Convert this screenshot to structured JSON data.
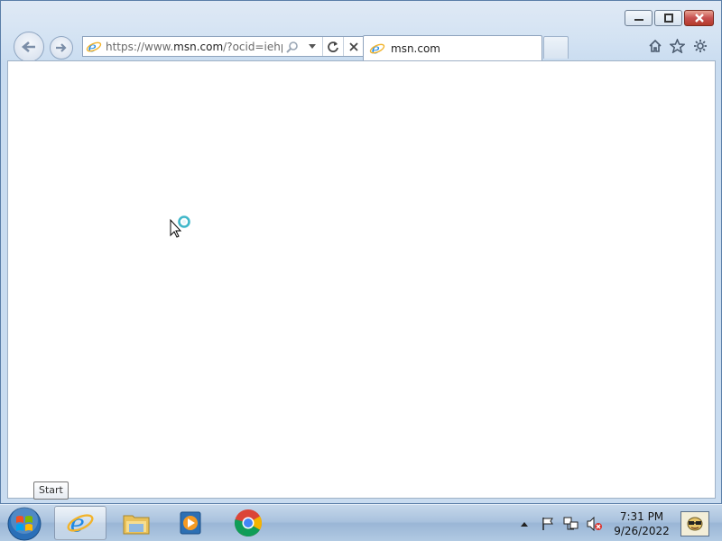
{
  "browser": {
    "address": {
      "prefix": "https://www.",
      "domain": "msn.com",
      "suffix": "/?ocid=iehp"
    },
    "tab": {
      "label": "msn.com"
    },
    "icons": [
      "ie-logo-icon",
      "search-icon",
      "dropdown-icon",
      "refresh-icon",
      "stop-icon",
      "home-icon",
      "favorites-star-icon",
      "settings-gear-icon"
    ]
  },
  "window_controls": [
    "minimize-icon",
    "restore-icon",
    "close-icon"
  ],
  "tooltip": {
    "text": "Start"
  },
  "taskbar": {
    "pinned": [
      "internet-explorer-icon",
      "file-explorer-icon",
      "media-player-icon",
      "chrome-icon"
    ],
    "tray": [
      "show-hidden-icons-icon",
      "action-center-flag-icon",
      "network-icon",
      "volume-muted-icon"
    ],
    "clock": {
      "time": "7:31 PM",
      "date": "9/26/2022"
    }
  },
  "colors": {
    "taskbar": "#a9c2de",
    "close_button": "#c75050",
    "ie_blue": "#1e88e5"
  }
}
